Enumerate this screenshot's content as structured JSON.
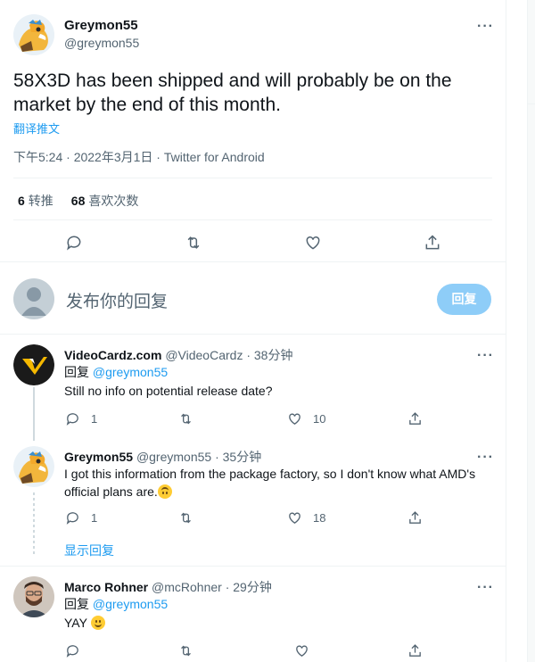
{
  "main_tweet": {
    "name": "Greymon55",
    "handle": "@greymon55",
    "text": "58X3D has been shipped and will probably be on the market by the end of this month.",
    "translate_label": "翻译推文",
    "meta": "下午5:24 · 2022年3月1日 · Twitter for Android",
    "retweets_count": "6",
    "retweets_label": "转推",
    "likes_count": "68",
    "likes_label": "喜欢次数",
    "avatar_icon": "agumon-avatar",
    "more_icon": "more-icon"
  },
  "reply_box": {
    "prompt": "发布你的回复",
    "button": "回复"
  },
  "replies": [
    {
      "name": "VideoCardz.com",
      "handle_time": "@VideoCardz · 38分钟",
      "reply_to_prefix": "回复",
      "reply_to": "@greymon55",
      "text": "Still no info on potential release date?",
      "reply_count": "1",
      "like_count": "10"
    },
    {
      "name": "Greymon55",
      "handle_time": "@greymon55 · 35分钟",
      "text_line1": "I got this information from the package factory, so I don't know what AMD's",
      "text_line2": "official plans are.",
      "emoji": "upside-down-face",
      "reply_count": "1",
      "like_count": "18"
    },
    {
      "name": "Marco Rohner",
      "handle_time": "@mcRohner · 29分钟",
      "reply_to_prefix": "回复",
      "reply_to": "@greymon55",
      "text": "YAY",
      "emoji": "grinning-face"
    }
  ],
  "show_replies": "显示回复",
  "colors": {
    "link": "#1d9bf0",
    "secondary_text": "#536471",
    "reply_button_disabled": "#8ecdf8"
  }
}
